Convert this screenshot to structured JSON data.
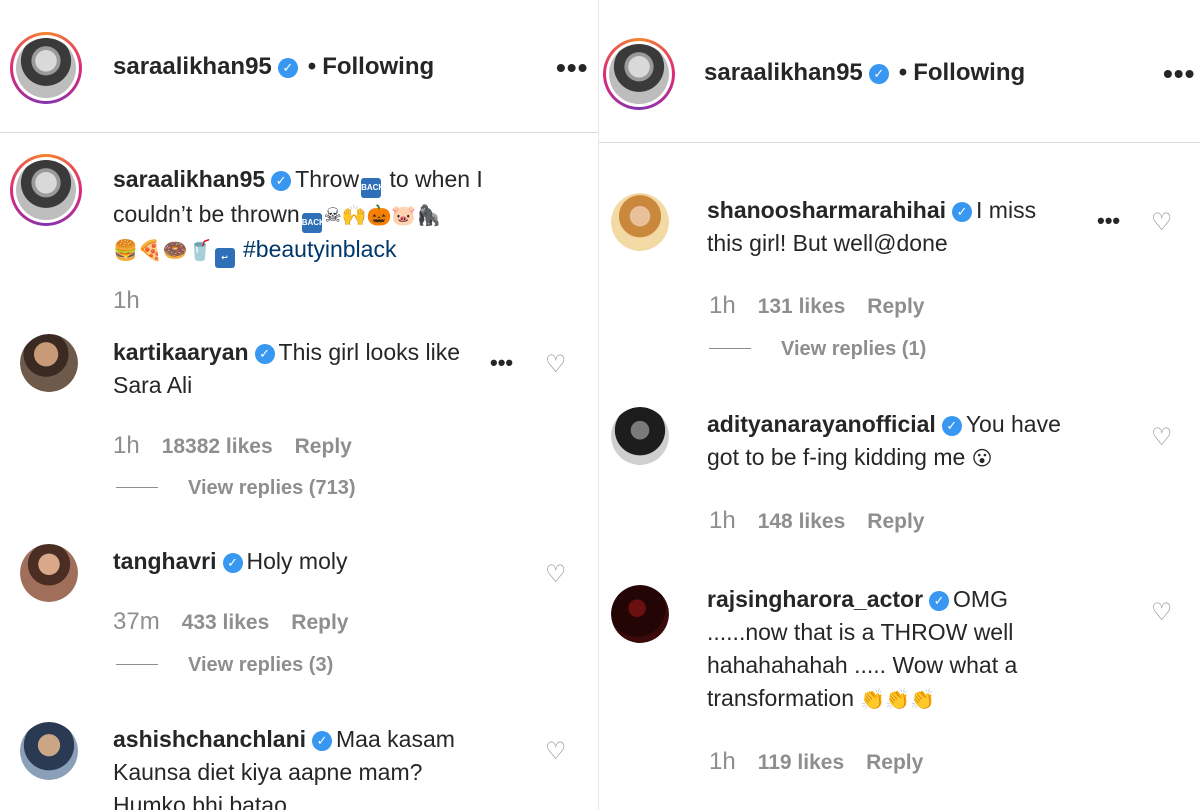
{
  "left": {
    "header": {
      "username": "saraalikhan95",
      "separator": "•",
      "following": "Following",
      "more": "•••"
    },
    "caption": {
      "username": "saraalikhan95",
      "text_1": "Throw",
      "text_2": " to when I",
      "text_3": "couldn’t be thrown",
      "emojis": "☠🙌🎃🐷🦍",
      "emojis_2": "🍔🍕🍩🥤",
      "hashtag": "#beautyinblack",
      "time": "1h"
    },
    "comments": [
      {
        "username": "kartikaaryan",
        "line1": "This girl looks like",
        "line2": "Sara Ali",
        "time": "1h",
        "likes": "18382 likes",
        "reply": "Reply",
        "view_replies": "View replies (713)"
      },
      {
        "username": "tanghavri",
        "line1": "Holy moly",
        "time": "37m",
        "likes": "433 likes",
        "reply": "Reply",
        "view_replies": "View replies (3)"
      },
      {
        "username": "ashishchanchlani",
        "line1": "Maa kasam",
        "line2": "Kaunsa diet kiya aapne mam?",
        "line3": "Humko bhi batao"
      }
    ]
  },
  "right": {
    "header": {
      "username": "saraalikhan95",
      "separator": "•",
      "following": "Following",
      "more": "•••"
    },
    "comments": [
      {
        "username": "shanoosharmarahihai",
        "line1": "I miss",
        "line2": "this girl! But well@done",
        "time": "1h",
        "likes": "131 likes",
        "reply": "Reply",
        "view_replies": "View replies (1)"
      },
      {
        "username": "adityanarayanofficial",
        "line1": "You have",
        "line2": "got to be f-ing kidding me",
        "emoji": "😮",
        "time": "1h",
        "likes": "148 likes",
        "reply": "Reply"
      },
      {
        "username": "rajsingharora_actor",
        "line1": "OMG",
        "line2": "......now that is a THROW well",
        "line3": "hahahahahah ..... Wow what a",
        "line4": "transformation",
        "emoji": "👏👏👏",
        "time": "1h",
        "likes": "119 likes",
        "reply": "Reply"
      }
    ]
  },
  "icons": {
    "verified": "✓",
    "heart": "♡"
  },
  "colors": {
    "verified": "#3897f0",
    "hashtag": "#00376b",
    "muted": "#8e8e8e",
    "text": "#262626"
  }
}
